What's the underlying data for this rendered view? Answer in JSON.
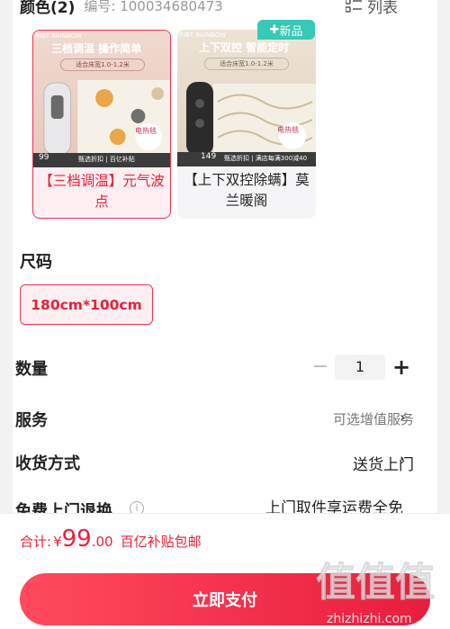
{
  "color_section": {
    "title": "颜色(2)",
    "sku": "编号: 100034680473",
    "view_toggle_label": "列表"
  },
  "variants": [
    {
      "caption": "【三档调温】元气波点",
      "selected": true,
      "thumb_banner": "三档调温 操作简单",
      "thumb_sub": "适合床宽1.0-1.2米",
      "thumb_brand": "RIBT RAINBOW",
      "thumb_price": "99",
      "thumb_tag": "甄选折扣 | 百亿补贴",
      "thumb_badge": "电热毯"
    },
    {
      "caption": "【上下双控除螨】莫兰暖阁",
      "selected": false,
      "badge": "新品",
      "thumb_banner": "上下双控 智能定时",
      "thumb_sub": "适合床宽1.0-1.2米",
      "thumb_brand": "RIBT RAINBOW",
      "thumb_price": "149",
      "thumb_tag": "甄选折扣 | 满店每满300减40",
      "thumb_badge": "电热毯"
    }
  ],
  "size": {
    "label": "尺码",
    "selected": "180cm*100cm"
  },
  "quantity": {
    "label": "数量",
    "value": "1",
    "minus": "−",
    "plus": "+"
  },
  "service": {
    "label": "服务",
    "value": "可选增值服务"
  },
  "delivery": {
    "label": "收货方式",
    "value": "送货上门"
  },
  "free_pickup": {
    "label": "免费上门退换",
    "value": "上门取件享运费全免"
  },
  "footer": {
    "total_label": "合计:",
    "currency": "¥",
    "price_int": "99",
    "price_dec": ".00",
    "note": "百亿补贴包邮",
    "pay_button": "立即支付"
  },
  "watermark": {
    "logo": "值值值",
    "url": "zhizhizhi.com"
  },
  "colors": {
    "accent": "#e8203b",
    "accent_bg": "#fdeff1",
    "badge_green": "#35c9b6"
  }
}
